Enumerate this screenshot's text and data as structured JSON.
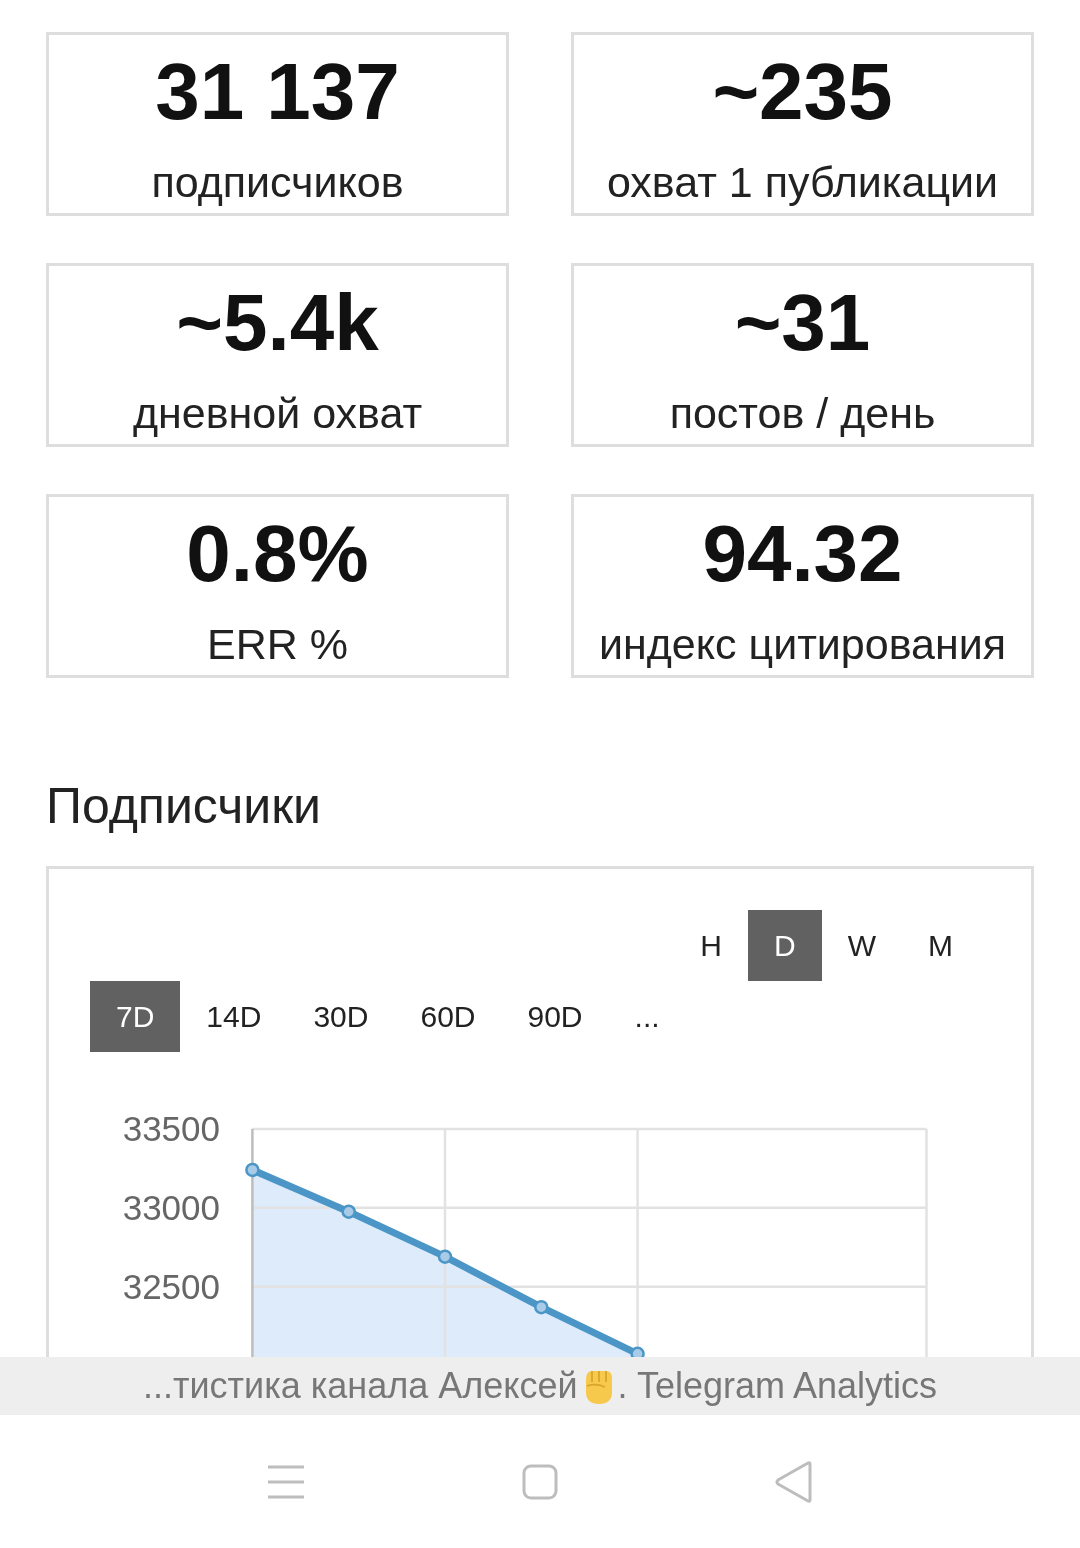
{
  "stats": [
    {
      "value": "31 137",
      "label": "подписчиков"
    },
    {
      "value": "~235",
      "label": "охват 1 публикации"
    },
    {
      "value": "~5.4k",
      "label": "дневной охват"
    },
    {
      "value": "~31",
      "label": "постов / день"
    },
    {
      "value": "0.8%",
      "label": "ERR %"
    },
    {
      "value": "94.32",
      "label": "индекс цитирования"
    }
  ],
  "section_title": "Подписчики",
  "chart_card": {
    "intervals": [
      {
        "label": "H",
        "selected": false
      },
      {
        "label": "D",
        "selected": true
      },
      {
        "label": "W",
        "selected": false
      },
      {
        "label": "M",
        "selected": false
      }
    ],
    "ranges": [
      {
        "label": "7D",
        "selected": true
      },
      {
        "label": "14D",
        "selected": false
      },
      {
        "label": "30D",
        "selected": false
      },
      {
        "label": "60D",
        "selected": false
      },
      {
        "label": "90D",
        "selected": false
      },
      {
        "label": "...",
        "selected": false
      }
    ],
    "chart_data": {
      "type": "area",
      "categories": [
        null,
        null,
        null,
        null,
        null,
        null,
        null,
        null
      ],
      "values": [
        33240,
        32975,
        32690,
        32370,
        32075,
        null,
        null,
        null
      ],
      "ylim": [
        32000,
        33500
      ],
      "yticks": [
        {
          "value": 32500,
          "label": "32500"
        },
        {
          "value": 33000,
          "label": "33000"
        },
        {
          "value": 33500,
          "label": "33500"
        }
      ],
      "grid": true
    }
  },
  "page_title_bar": {
    "text_parts": [
      "...тистика канала Алексей",
      ". Telegram Analytics"
    ]
  }
}
